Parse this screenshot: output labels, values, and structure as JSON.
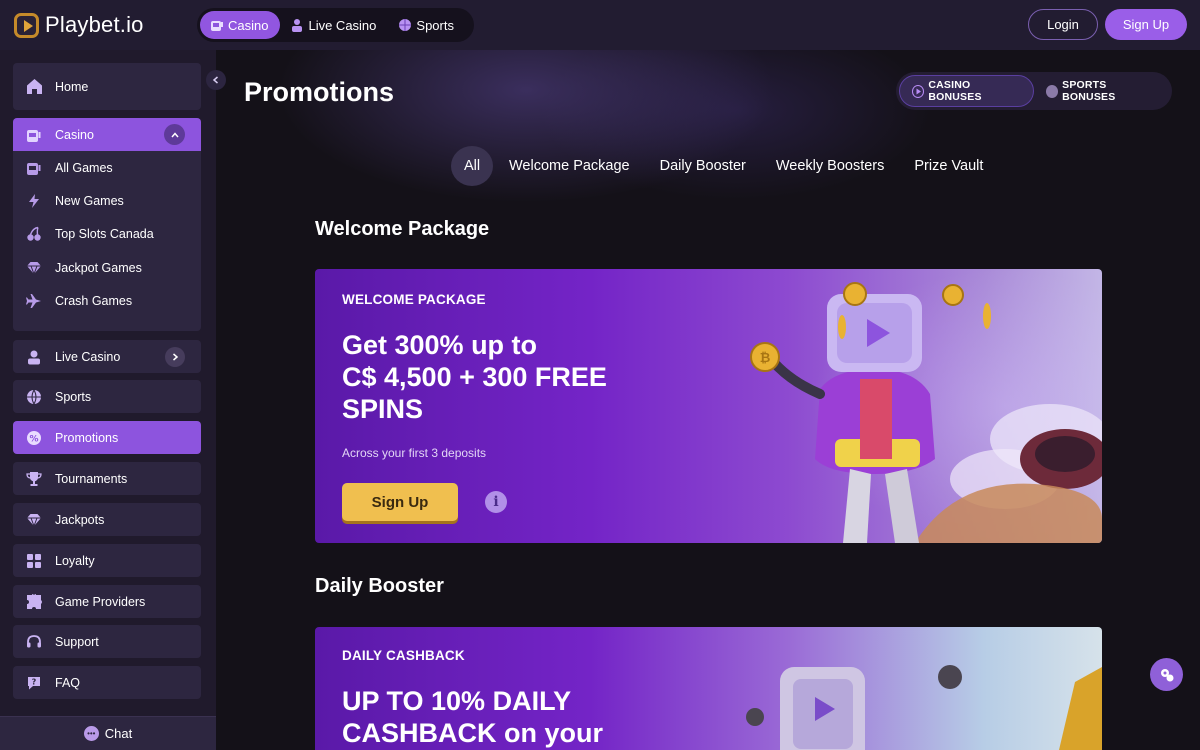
{
  "header": {
    "logo_text": "Playbet.io",
    "tabs": [
      {
        "label": "Casino",
        "icon": "slot-machine-icon",
        "active": true
      },
      {
        "label": "Live Casino",
        "icon": "dealer-icon",
        "active": false
      },
      {
        "label": "Sports",
        "icon": "ball-icon",
        "active": false
      }
    ],
    "login_label": "Login",
    "signup_label": "Sign Up"
  },
  "sidebar": {
    "home": {
      "label": "Home",
      "icon": "home-icon"
    },
    "casino": {
      "label": "Casino",
      "icon": "slot-machine-icon",
      "expanded": true,
      "items": [
        {
          "label": "All Games",
          "icon": "slot-machine-icon"
        },
        {
          "label": "New Games",
          "icon": "lightning-icon"
        },
        {
          "label": "Top Slots Canada",
          "icon": "cherries-icon"
        },
        {
          "label": "Jackpot Games",
          "icon": "diamond-icon"
        },
        {
          "label": "Crash Games",
          "icon": "airplane-icon"
        }
      ]
    },
    "items": [
      {
        "label": "Live Casino",
        "icon": "dealer-icon",
        "has_chevron": true,
        "active": false
      },
      {
        "label": "Sports",
        "icon": "ball-icon",
        "has_chevron": false,
        "active": false
      },
      {
        "label": "Promotions",
        "icon": "promo-badge-icon",
        "has_chevron": false,
        "active": true
      },
      {
        "label": "Tournaments",
        "icon": "trophy-icon",
        "has_chevron": false,
        "active": false
      },
      {
        "label": "Jackpots",
        "icon": "diamond-icon",
        "has_chevron": false,
        "active": false
      },
      {
        "label": "Loyalty",
        "icon": "grid-icon",
        "has_chevron": false,
        "active": false
      },
      {
        "label": "Game Providers",
        "icon": "puzzle-icon",
        "has_chevron": false,
        "active": false
      },
      {
        "label": "Support",
        "icon": "headset-icon",
        "has_chevron": false,
        "active": false
      },
      {
        "label": "FAQ",
        "icon": "question-bubble-icon",
        "has_chevron": false,
        "active": false
      }
    ],
    "chat_label": "Chat"
  },
  "main": {
    "title": "Promotions",
    "bonus_toggle": [
      {
        "label": "CASINO BONUSES",
        "active": true
      },
      {
        "label": "SPORTS BONUSES",
        "active": false
      }
    ],
    "filters": [
      {
        "label": "All",
        "active": true
      },
      {
        "label": "Welcome Package",
        "active": false
      },
      {
        "label": "Daily Booster",
        "active": false
      },
      {
        "label": "Weekly Boosters",
        "active": false
      },
      {
        "label": "Prize Vault",
        "active": false
      }
    ],
    "sections": [
      {
        "title": "Welcome Package",
        "card": {
          "label": "WELCOME PACKAGE",
          "headline": [
            "Get 300% up to",
            "C$ 4,500 + 300 FREE",
            "SPINS"
          ],
          "subtext": "Across your first 3 deposits",
          "cta_label": "Sign Up"
        }
      },
      {
        "title": "Daily Booster",
        "card": {
          "label": "DAILY CASHBACK",
          "headline": [
            "UP TO 10% DAILY",
            "CASHBACK on your"
          ]
        }
      }
    ]
  },
  "colors": {
    "accent": "#8d54de",
    "header_bg": "#221c31",
    "sidebar_bg": "#201a2c",
    "page_bg": "#141118",
    "cta_yellow": "#f0bf4f"
  }
}
